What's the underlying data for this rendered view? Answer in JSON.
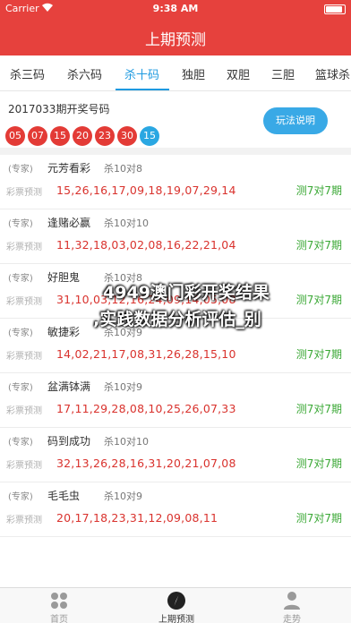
{
  "status_bar": {
    "carrier": "Carrier",
    "time": "9:38 AM",
    "battery_level": 0.9
  },
  "nav": {
    "title": "上期预测"
  },
  "tabs": [
    {
      "label": "杀三码",
      "active": false
    },
    {
      "label": "杀六码",
      "active": false
    },
    {
      "label": "杀十码",
      "active": true
    },
    {
      "label": "独胆",
      "active": false
    },
    {
      "label": "双胆",
      "active": false
    },
    {
      "label": "三胆",
      "active": false
    },
    {
      "label": "篮球杀",
      "active": false
    }
  ],
  "draw": {
    "title": "2017033期开奖号码",
    "red_balls": [
      "05",
      "07",
      "15",
      "20",
      "23",
      "30"
    ],
    "blue_ball": "15",
    "rules_button": "玩法说明"
  },
  "predictions": [
    {
      "tag": "(专家)",
      "name": "元芳看彩",
      "record": "杀10对8",
      "subtag": "彩票预测",
      "numbers": "15,26,16,17,09,18,19,07,29,14",
      "stat": "测7对7期"
    },
    {
      "tag": "(专家)",
      "name": "逢赌必赢",
      "record": "杀10对10",
      "subtag": "彩票预测",
      "numbers": "11,32,18,03,02,08,16,22,21,04",
      "stat": "测7对7期"
    },
    {
      "tag": "(专家)",
      "name": "好胆鬼",
      "record": "杀10对8",
      "subtag": "彩票预测",
      "numbers": "31,10,03,12,16,24,09,14,05,08",
      "stat": "测7对7期"
    },
    {
      "tag": "(专家)",
      "name": "敏捷彩",
      "record": "杀10对9",
      "subtag": "彩票预测",
      "numbers": "14,02,21,17,08,31,26,28,15,10",
      "stat": "测7对7期"
    },
    {
      "tag": "(专家)",
      "name": "盆满钵满",
      "record": "杀10对9",
      "subtag": "彩票预测",
      "numbers": "17,11,29,28,08,10,25,26,07,33",
      "stat": "测7对7期"
    },
    {
      "tag": "(专家)",
      "name": "码到成功",
      "record": "杀10对10",
      "subtag": "彩票预测",
      "numbers": "32,13,26,28,16,31,20,21,07,08",
      "stat": "测7对7期"
    },
    {
      "tag": "(专家)",
      "name": "毛毛虫",
      "record": "杀10对9",
      "subtag": "彩票预测",
      "numbers": "20,17,18,23,31,12,09,08,11",
      "stat": "测7对7期"
    }
  ],
  "overlay": {
    "line1": "4949澳门彩开奖结果",
    "line2": ",实践数据分析评估_别"
  },
  "tab_bar": [
    {
      "label": "首页",
      "icon": "grid-icon",
      "active": false
    },
    {
      "label": "上期预测",
      "icon": "compass-icon",
      "active": true
    },
    {
      "label": "走势",
      "icon": "person-icon",
      "active": false
    }
  ]
}
